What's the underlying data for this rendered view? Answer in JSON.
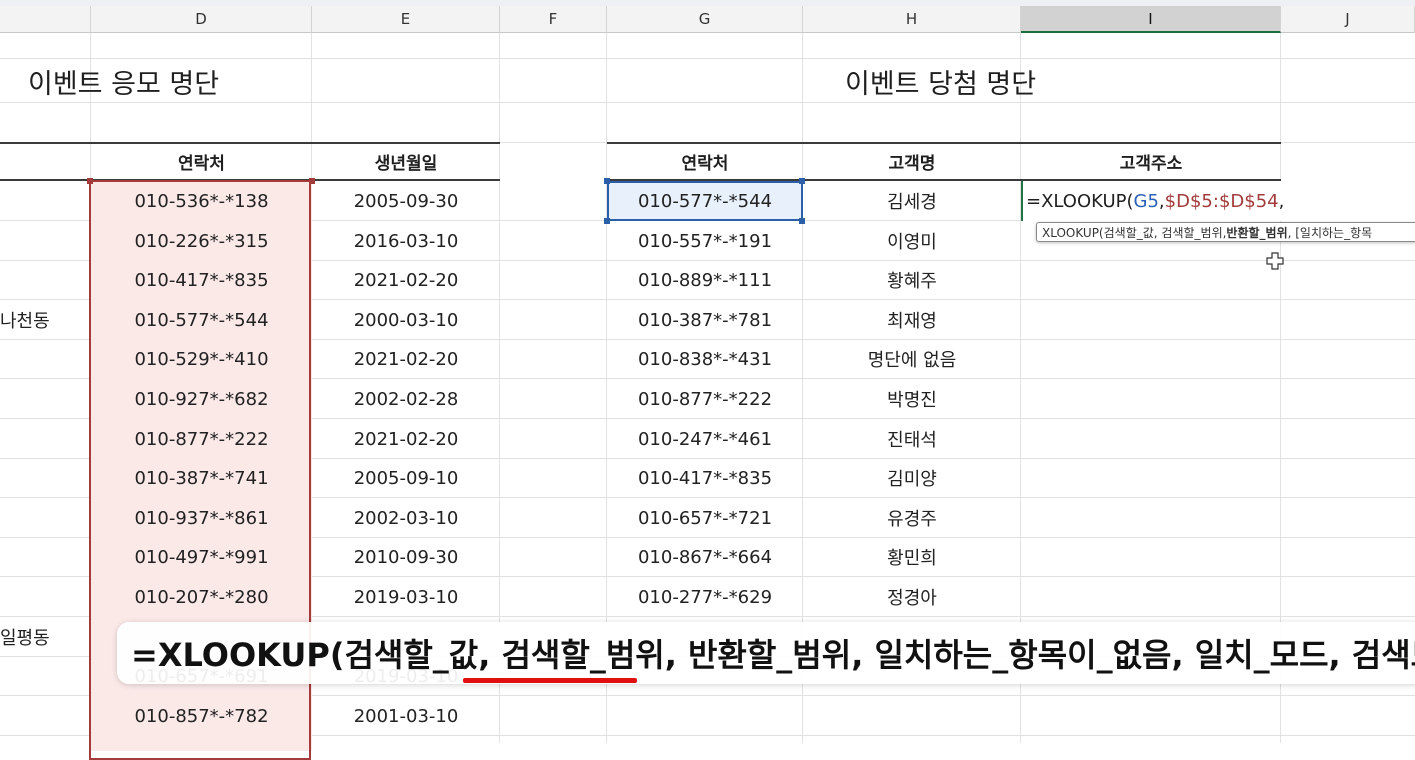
{
  "columns": [
    {
      "letter": "D",
      "selected": false
    },
    {
      "letter": "E",
      "selected": false
    },
    {
      "letter": "F",
      "selected": false
    },
    {
      "letter": "G",
      "selected": false
    },
    {
      "letter": "H",
      "selected": false
    },
    {
      "letter": "I",
      "selected": true
    },
    {
      "letter": "J",
      "selected": false
    }
  ],
  "left_table": {
    "title": "이벤트 응모 명단",
    "headers": {
      "contact": "연락처",
      "birth": "생년월일"
    },
    "rows": [
      {
        "addr": "",
        "contact": "010-536*-*138",
        "birth": "2005-09-30"
      },
      {
        "addr": "",
        "contact": "010-226*-*315",
        "birth": "2016-03-10"
      },
      {
        "addr": "",
        "contact": "010-417*-*835",
        "birth": "2021-02-20"
      },
      {
        "addr": "나천동",
        "contact": "010-577*-*544",
        "birth": "2000-03-10"
      },
      {
        "addr": "",
        "contact": "010-529*-*410",
        "birth": "2021-02-20"
      },
      {
        "addr": "",
        "contact": "010-927*-*682",
        "birth": "2002-02-28"
      },
      {
        "addr": "",
        "contact": "010-877*-*222",
        "birth": "2021-02-20"
      },
      {
        "addr": "",
        "contact": "010-387*-*741",
        "birth": "2005-09-10"
      },
      {
        "addr": "",
        "contact": "010-937*-*861",
        "birth": "2002-03-10"
      },
      {
        "addr": "",
        "contact": "010-497*-*991",
        "birth": "2010-09-30"
      },
      {
        "addr": "",
        "contact": "010-207*-*280",
        "birth": "2019-03-10"
      },
      {
        "addr": "일평동",
        "contact": "",
        "birth": ""
      },
      {
        "addr": "",
        "contact": "010-657*-*691",
        "birth": "2019-03-10"
      },
      {
        "addr": "",
        "contact": "010-857*-*782",
        "birth": "2001-03-10"
      }
    ]
  },
  "right_table": {
    "title": "이벤트 당첨 명단",
    "headers": {
      "contact": "연락처",
      "name": "고객명",
      "address": "고객주소"
    },
    "rows": [
      {
        "contact": "010-577*-*544",
        "name": "김세경"
      },
      {
        "contact": "010-557*-*191",
        "name": "이영미"
      },
      {
        "contact": "010-889*-*111",
        "name": "황혜주"
      },
      {
        "contact": "010-387*-*781",
        "name": "최재영"
      },
      {
        "contact": "010-838*-*431",
        "name": "명단에 없음"
      },
      {
        "contact": "010-877*-*222",
        "name": "박명진"
      },
      {
        "contact": "010-247*-*461",
        "name": "진태석"
      },
      {
        "contact": "010-417*-*835",
        "name": "김미양"
      },
      {
        "contact": "010-657*-*721",
        "name": "유경주"
      },
      {
        "contact": "010-867*-*664",
        "name": "황민희"
      },
      {
        "contact": "010-277*-*629",
        "name": "정경아"
      }
    ]
  },
  "formula": {
    "prefix": "=XLOOKUP(",
    "ref1": "G5",
    "sep1": ",",
    "ref2": "$D$5:$D$54",
    "sep2": ","
  },
  "tooltip": {
    "part1": "XLOOKUP(검색할_값, 검색할_범위, ",
    "bold": "반환할_범위",
    "part2": ", [일치하는_항목"
  },
  "subtitle": {
    "text": "=XLOOKUP(검색할_값, 검색할_범위, 반환할_범위, 일치하는_항목이_없음, 일치_모드, 검색모"
  },
  "colors": {
    "copy_range_border": "#a33b3b",
    "active_cell_border": "#2b5fa8",
    "highlight_underline": "#e01010"
  }
}
